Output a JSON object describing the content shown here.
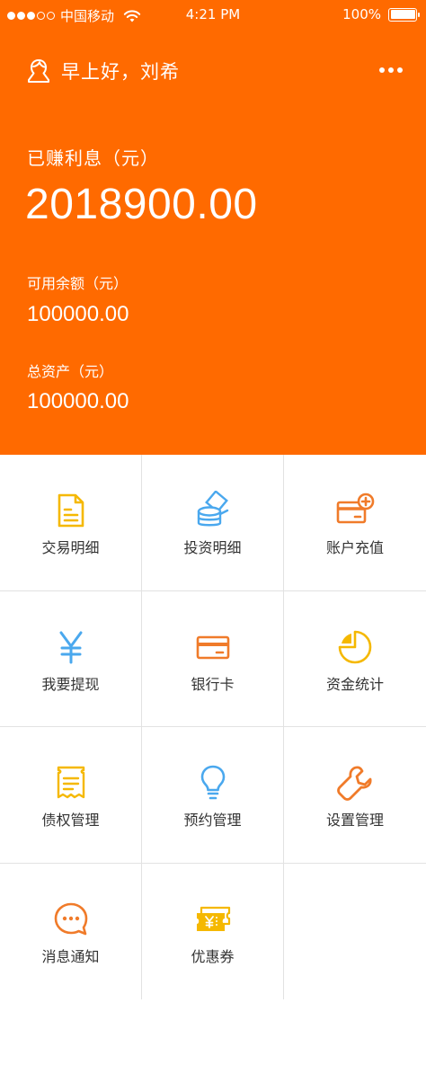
{
  "status_bar": {
    "carrier": "中国移动",
    "time": "4:21 PM",
    "battery": "100%"
  },
  "header": {
    "greeting": "早上好，刘希",
    "earned_label": "已赚利息（元）",
    "earned_value": "2018900.00",
    "available_label": "可用余额（元）",
    "available_value": "100000.00",
    "total_label": "总资产（元）",
    "total_value": "100000.00"
  },
  "colors": {
    "brand": "#ff6a00",
    "yellow": "#f5b800",
    "blue": "#4aa8ee",
    "orange": "#f07b2a"
  },
  "menu": [
    {
      "label": "交易明细",
      "icon": "document-icon"
    },
    {
      "label": "投资明细",
      "icon": "coins-icon"
    },
    {
      "label": "账户充值",
      "icon": "card-plus-icon"
    },
    {
      "label": "我要提现",
      "icon": "yen-icon"
    },
    {
      "label": "银行卡",
      "icon": "bank-card-icon"
    },
    {
      "label": "资金统计",
      "icon": "pie-chart-icon"
    },
    {
      "label": "债权管理",
      "icon": "receipt-icon"
    },
    {
      "label": "预约管理",
      "icon": "lightbulb-icon"
    },
    {
      "label": "设置管理",
      "icon": "wrench-icon"
    },
    {
      "label": "消息通知",
      "icon": "chat-bubble-icon"
    },
    {
      "label": "优惠券",
      "icon": "coupon-icon"
    }
  ]
}
